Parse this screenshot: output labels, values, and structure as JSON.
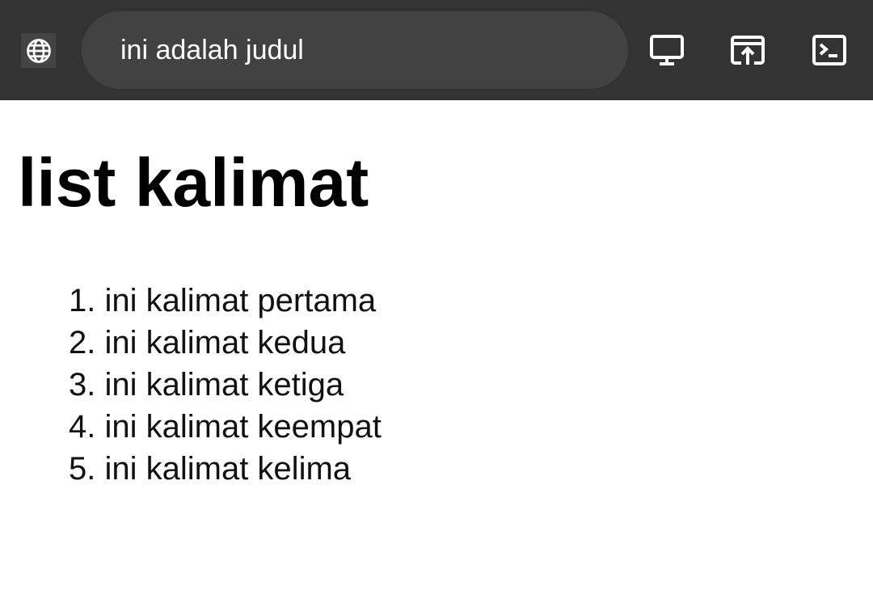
{
  "toolbar": {
    "address_text": "ini adalah judul",
    "icons": [
      "globe-icon",
      "desktop-icon",
      "open-external-icon",
      "console-icon"
    ],
    "background": "#333333",
    "address_bar_background": "#424242"
  },
  "page": {
    "title": "list kalimat",
    "items": [
      {
        "number": "1.",
        "text": "ini kalimat pertama"
      },
      {
        "number": "2.",
        "text": "ini kalimat kedua"
      },
      {
        "number": "3.",
        "text": "ini kalimat ketiga"
      },
      {
        "number": "4.",
        "text": "ini kalimat keempat"
      },
      {
        "number": "5.",
        "text": "ini kalimat kelima"
      }
    ]
  }
}
